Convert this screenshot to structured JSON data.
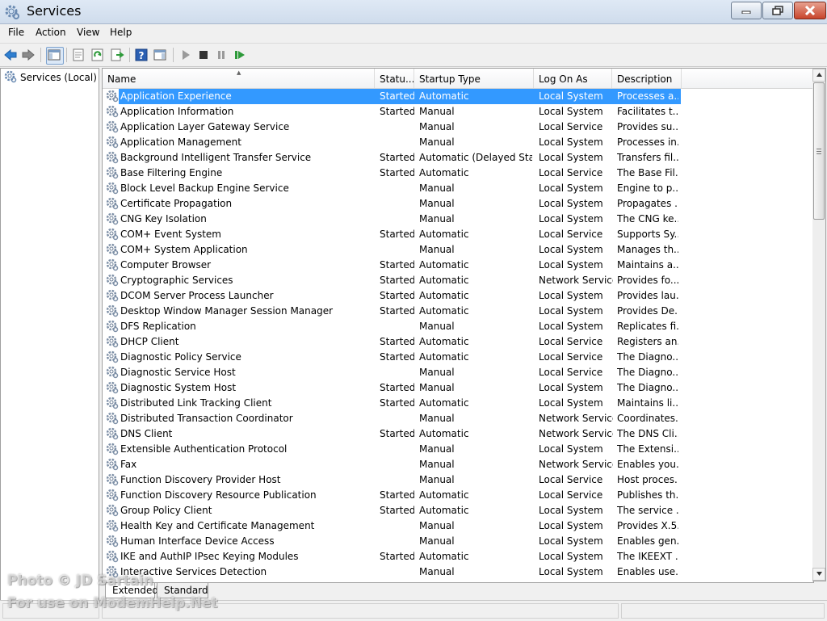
{
  "window": {
    "title": "Services",
    "icon": "gear-icon"
  },
  "menu": [
    "File",
    "Action",
    "View",
    "Help"
  ],
  "toolbar": {
    "icons": [
      "back-arrow-icon",
      "forward-arrow-icon",
      "show-hide-console-tree-icon",
      "properties-icon",
      "refresh-icon",
      "export-list-icon",
      "help-icon",
      "action-pane-icon",
      "start-service-icon",
      "stop-service-icon",
      "pause-service-icon",
      "restart-service-icon"
    ]
  },
  "tree": {
    "node_label": "Services (Local)"
  },
  "columns": {
    "name": "Name",
    "status": "Statu...",
    "startup": "Startup Type",
    "logon": "Log On As",
    "desc": "Description"
  },
  "services": [
    {
      "name": "Application Experience",
      "status": "Started",
      "startup": "Automatic",
      "logon": "Local System",
      "desc": "Processes a..."
    },
    {
      "name": "Application Information",
      "status": "Started",
      "startup": "Manual",
      "logon": "Local System",
      "desc": "Facilitates t..."
    },
    {
      "name": "Application Layer Gateway Service",
      "status": "",
      "startup": "Manual",
      "logon": "Local Service",
      "desc": "Provides su..."
    },
    {
      "name": "Application Management",
      "status": "",
      "startup": "Manual",
      "logon": "Local System",
      "desc": "Processes in..."
    },
    {
      "name": "Background Intelligent Transfer Service",
      "status": "Started",
      "startup": "Automatic (Delayed Start)",
      "logon": "Local System",
      "desc": "Transfers fil..."
    },
    {
      "name": "Base Filtering Engine",
      "status": "Started",
      "startup": "Automatic",
      "logon": "Local Service",
      "desc": "The Base Fil..."
    },
    {
      "name": "Block Level Backup Engine Service",
      "status": "",
      "startup": "Manual",
      "logon": "Local System",
      "desc": "Engine to p..."
    },
    {
      "name": "Certificate Propagation",
      "status": "",
      "startup": "Manual",
      "logon": "Local System",
      "desc": "Propagates ..."
    },
    {
      "name": "CNG Key Isolation",
      "status": "",
      "startup": "Manual",
      "logon": "Local System",
      "desc": "The CNG ke..."
    },
    {
      "name": "COM+ Event System",
      "status": "Started",
      "startup": "Automatic",
      "logon": "Local Service",
      "desc": "Supports Sy..."
    },
    {
      "name": "COM+ System Application",
      "status": "",
      "startup": "Manual",
      "logon": "Local System",
      "desc": "Manages th..."
    },
    {
      "name": "Computer Browser",
      "status": "Started",
      "startup": "Automatic",
      "logon": "Local System",
      "desc": "Maintains a..."
    },
    {
      "name": "Cryptographic Services",
      "status": "Started",
      "startup": "Automatic",
      "logon": "Network Service",
      "desc": "Provides fo..."
    },
    {
      "name": "DCOM Server Process Launcher",
      "status": "Started",
      "startup": "Automatic",
      "logon": "Local System",
      "desc": "Provides lau..."
    },
    {
      "name": "Desktop Window Manager Session Manager",
      "status": "Started",
      "startup": "Automatic",
      "logon": "Local System",
      "desc": "Provides De..."
    },
    {
      "name": "DFS Replication",
      "status": "",
      "startup": "Manual",
      "logon": "Local System",
      "desc": "Replicates fi..."
    },
    {
      "name": "DHCP Client",
      "status": "Started",
      "startup": "Automatic",
      "logon": "Local Service",
      "desc": "Registers an..."
    },
    {
      "name": "Diagnostic Policy Service",
      "status": "Started",
      "startup": "Automatic",
      "logon": "Local Service",
      "desc": "The Diagno..."
    },
    {
      "name": "Diagnostic Service Host",
      "status": "",
      "startup": "Manual",
      "logon": "Local Service",
      "desc": "The Diagno..."
    },
    {
      "name": "Diagnostic System Host",
      "status": "Started",
      "startup": "Manual",
      "logon": "Local System",
      "desc": "The Diagno..."
    },
    {
      "name": "Distributed Link Tracking Client",
      "status": "Started",
      "startup": "Automatic",
      "logon": "Local System",
      "desc": "Maintains li..."
    },
    {
      "name": "Distributed Transaction Coordinator",
      "status": "",
      "startup": "Manual",
      "logon": "Network Service",
      "desc": "Coordinates..."
    },
    {
      "name": "DNS Client",
      "status": "Started",
      "startup": "Automatic",
      "logon": "Network Service",
      "desc": "The DNS Cli..."
    },
    {
      "name": "Extensible Authentication Protocol",
      "status": "",
      "startup": "Manual",
      "logon": "Local System",
      "desc": "The Extensi..."
    },
    {
      "name": "Fax",
      "status": "",
      "startup": "Manual",
      "logon": "Network Service",
      "desc": "Enables you..."
    },
    {
      "name": "Function Discovery Provider Host",
      "status": "",
      "startup": "Manual",
      "logon": "Local Service",
      "desc": "Host proces..."
    },
    {
      "name": "Function Discovery Resource Publication",
      "status": "Started",
      "startup": "Automatic",
      "logon": "Local Service",
      "desc": "Publishes th..."
    },
    {
      "name": "Group Policy Client",
      "status": "Started",
      "startup": "Automatic",
      "logon": "Local System",
      "desc": "The service ..."
    },
    {
      "name": "Health Key and Certificate Management",
      "status": "",
      "startup": "Manual",
      "logon": "Local System",
      "desc": "Provides X.5..."
    },
    {
      "name": "Human Interface Device Access",
      "status": "",
      "startup": "Manual",
      "logon": "Local System",
      "desc": "Enables gen..."
    },
    {
      "name": "IKE and AuthIP IPsec Keying Modules",
      "status": "Started",
      "startup": "Automatic",
      "logon": "Local System",
      "desc": "The IKEEXT ..."
    },
    {
      "name": "Interactive Services Detection",
      "status": "",
      "startup": "Manual",
      "logon": "Local System",
      "desc": "Enables use..."
    }
  ],
  "selected_index": 0,
  "tabs": [
    "Extended",
    "Standard"
  ],
  "watermark": {
    "line1": "Photo © JD Sartain",
    "line2": "For use on ModemHelp.Net"
  }
}
